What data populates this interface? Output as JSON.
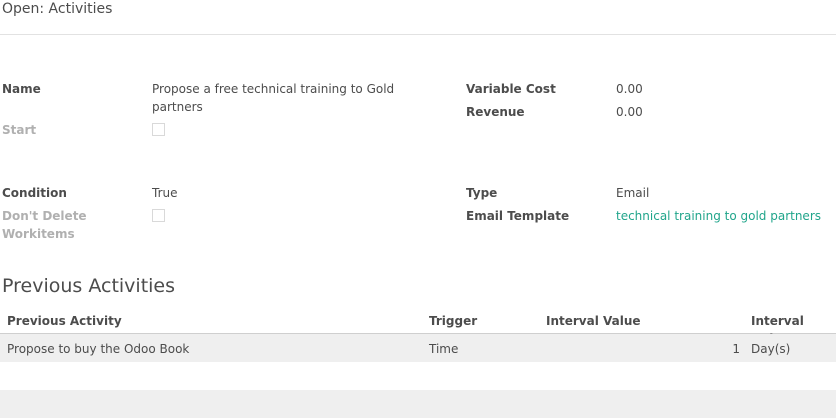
{
  "header": {
    "title": "Open: Activities"
  },
  "form": {
    "left": {
      "name_label": "Name",
      "name_value": "Propose a free technical training to Gold partners",
      "start_label": "Start",
      "start_checked": false,
      "condition_label": "Condition",
      "condition_value": "True",
      "dont_delete_label": "Don't Delete Workitems",
      "dont_delete_checked": false
    },
    "right": {
      "variable_cost_label": "Variable Cost",
      "variable_cost_value": "0.00",
      "revenue_label": "Revenue",
      "revenue_value": "0.00",
      "type_label": "Type",
      "type_value": "Email",
      "email_template_label": "Email Template",
      "email_template_value": "technical training to gold partners"
    }
  },
  "previous_activities": {
    "title": "Previous Activities",
    "columns": [
      "Previous Activity",
      "Trigger",
      "Interval Value",
      "Interval Unit"
    ],
    "rows": [
      {
        "previous_activity": "Propose to buy the Odoo Book",
        "trigger": "Time",
        "interval_value": "1",
        "interval_unit": "Day(s)"
      }
    ]
  },
  "colors": {
    "link": "#21a58b",
    "row_bg": "#efefef",
    "muted_label": "#b0b0b0"
  }
}
